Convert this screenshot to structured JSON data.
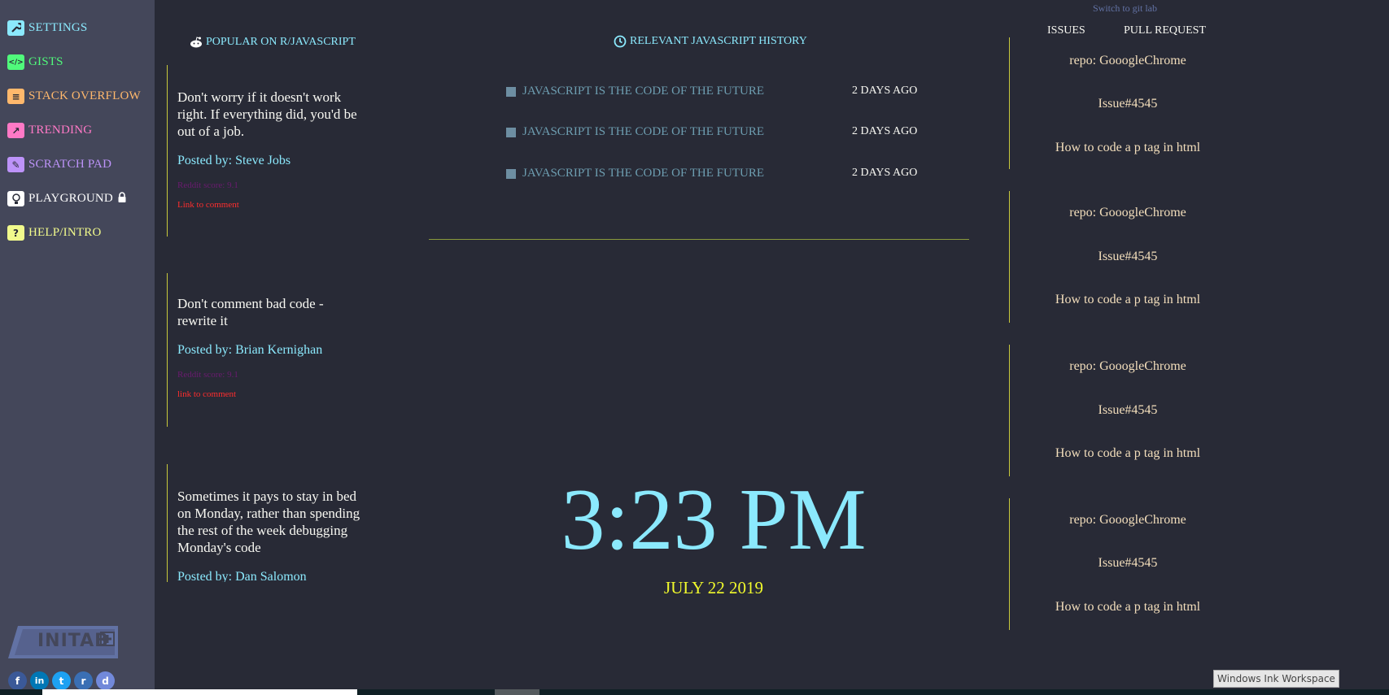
{
  "sidebar": {
    "items": [
      {
        "label": "SETTINGS",
        "icon": "wrench-icon",
        "color": "#8be9fd",
        "glyph": "✎"
      },
      {
        "label": "GISTS",
        "icon": "code-icon",
        "color": "#50fa7b",
        "glyph": "</>"
      },
      {
        "label": "STACK OVERFLOW",
        "icon": "stack-overflow-icon",
        "color": "#ffb86c",
        "glyph": "≡"
      },
      {
        "label": "TRENDING",
        "icon": "chart-icon",
        "color": "#ff79c6",
        "glyph": "↗"
      },
      {
        "label": "SCRATCH PAD",
        "icon": "pencil-icon",
        "color": "#bd93f9",
        "glyph": "✎"
      },
      {
        "label": "PLAYGROUND",
        "icon": "bulb-icon",
        "color": "#ffffff",
        "glyph": "💡"
      },
      {
        "label": "HELP/INTRO",
        "icon": "question-icon",
        "color": "#f1fa8c",
        "glyph": "?"
      }
    ],
    "logo": "INITAB",
    "social": [
      {
        "icon": "facebook-icon",
        "glyph": "f",
        "color": "#3b5998"
      },
      {
        "icon": "linkedin-icon",
        "glyph": "in",
        "color": "#0077b5"
      },
      {
        "icon": "twitter-icon",
        "glyph": "t",
        "color": "#1da1f2"
      },
      {
        "icon": "reddit-icon",
        "glyph": "r",
        "color": "#3a6fb4"
      },
      {
        "icon": "discord-icon",
        "glyph": "d",
        "color": "#7289da"
      }
    ]
  },
  "reddit": {
    "header": "POPULAR ON R/JAVASCRIPT",
    "posts": [
      {
        "text": "Don't worry if it doesn't work right. If everything did, you'd be out of a job.",
        "by": "Posted by: Steve Jobs",
        "score": "Reddit score: 9.1",
        "link": "Link to comment"
      },
      {
        "text": "Don't comment bad code - rewrite it",
        "by": "Posted by: Brian Kernighan",
        "score": "Reddit score: 9.1",
        "link": "link to comment"
      },
      {
        "text": "Sometimes it pays to stay in bed on Monday, rather than spending the rest of the week debugging Monday's code",
        "by": "Posted by: Dan Salomon",
        "score": "",
        "link": ""
      }
    ]
  },
  "history": {
    "header": "RELEVANT JAVASCRIPT HISTORY",
    "rows": [
      {
        "title": "JAVASCRIPT IS THE CODE OF THE FUTURE",
        "date": "2 DAYS AGO"
      },
      {
        "title": "JAVASCRIPT IS THE CODE OF THE FUTURE",
        "date": "2 DAYS AGO"
      },
      {
        "title": "JAVASCRIPT IS THE CODE OF THE FUTURE",
        "date": "2 DAYS AGO"
      }
    ]
  },
  "clock": {
    "time": "3:23 PM",
    "date": "JULY 22 2019"
  },
  "git": {
    "switch": "Switch to git lab",
    "tabs": [
      "ISSUES",
      "PULL REQUEST"
    ],
    "issues": [
      {
        "repo": "repo: GooogleChrome",
        "number": "Issue#4545",
        "title": "How to code a p tag in html"
      },
      {
        "repo": "repo: GooogleChrome",
        "number": "Issue#4545",
        "title": "How to code a p tag in html"
      },
      {
        "repo": "repo: GooogleChrome",
        "number": "Issue#4545",
        "title": "How to code a p tag in html"
      },
      {
        "repo": "repo: GooogleChrome",
        "number": "Issue#4545",
        "title": "How to code a p tag in html"
      }
    ]
  },
  "tray": {
    "label": "Windows Ink Workspace"
  },
  "colors": {
    "background": "#282a36",
    "sidebar": "#44475a",
    "accent": "#8be9fd",
    "date": "#f1fa2c",
    "divider": "#c8c83c"
  }
}
